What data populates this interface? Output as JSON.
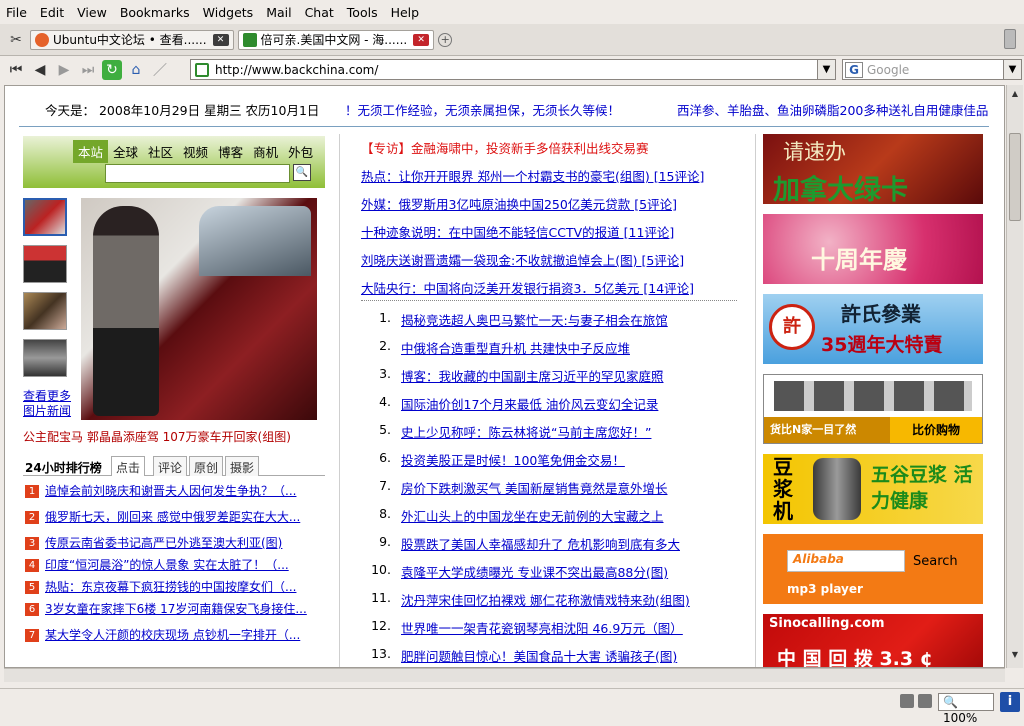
{
  "menu": [
    "File",
    "Edit",
    "View",
    "Bookmarks",
    "Widgets",
    "Mail",
    "Chat",
    "Tools",
    "Help"
  ],
  "tabs": [
    {
      "label": "Ubuntu中文论坛 • 查看......",
      "active": false,
      "icon_color": "#e5622a"
    },
    {
      "label": "倍可亲.美国中文网 - 海......",
      "active": true,
      "icon_color": "#2e8b2e"
    }
  ],
  "address": {
    "url": "http://www.backchina.com/"
  },
  "search": {
    "placeholder": "Google",
    "engine_icon": "G"
  },
  "status": {
    "zoom": "100%",
    "info": "i"
  },
  "page": {
    "date_line": "今天是： 2008年10月29日 星期三 农历10月1日",
    "top_ad1": "！无须工作经验，无须亲属担保，无须长久等候！",
    "top_ad2": "西洋参、羊胎盘、鱼油卵磷脂200多种送礼自用健康佳品",
    "green_tabs": [
      "本站",
      "全球",
      "社区",
      "视频",
      "博客",
      "商机",
      "外包"
    ],
    "more_photos": "查看更多图片新闻",
    "photo_caption": "公主配宝马 郭晶晶添座驾 107万豪车开回家(组图)",
    "rank_title": "24小时排行榜",
    "rank_tabs": [
      "点击",
      "评论",
      "原创",
      "摄影"
    ],
    "rank_items": [
      {
        "n": "1",
        "text": "追悼会前刘晓庆和谢晋夫人因何发生争执？（..."
      },
      {
        "n": "2",
        "text": "俄罗斯七天，刚回来 感觉中俄罗差距实在大大..."
      },
      {
        "n": "3",
        "text": "传原云南省委书记高严已外逃至澳大利亚(图)"
      },
      {
        "n": "4",
        "text": "印度“恒河晨浴”的惊人景象 实在太脏了！（..."
      },
      {
        "n": "5",
        "text": "热贴：东京夜幕下疯狂捞钱的中国按摩女们（..."
      },
      {
        "n": "6",
        "text": "3岁女童在家摔下6楼 17岁河南籍保安飞身接住..."
      },
      {
        "n": "7",
        "text": "某大学令人汗颜的校庆现场 点钞机一字排开（..."
      }
    ],
    "special": "【专访】金融海啸中，投资新手多倍获利出线交易赛",
    "headlines": [
      "热点：让你开开眼界 郑州一个村霸支书的豪宅(组图) [15评论]",
      "外媒：俄罗斯用3亿吨原油换中国250亿美元贷款 [5评论]",
      "十种迹象说明：在中国绝不能轻信CCTV的报道 [11评论]",
      "刘晓庆送谢晋遗孀一袋现金:不收就撤追悼会上(图) [5评论]",
      "大陆央行：中国将向泛美开发银行捐资3．5亿美元 [14评论]"
    ],
    "numbered": [
      {
        "n": "1.",
        "text": "揭秘竞选超人奥巴马繁忙一天:与妻子相会在旅馆"
      },
      {
        "n": "2.",
        "text": "中俄将合造重型直升机 共建快中子反应堆"
      },
      {
        "n": "3.",
        "text": "博客：我收藏的中国副主席习近平的罕见家庭照"
      },
      {
        "n": "4.",
        "text": "国际油价创17个月来最低 油价风云变幻全记录"
      },
      {
        "n": "5.",
        "text": "史上少见称呼：陈云林将说“马前主席您好！”"
      },
      {
        "n": "6.",
        "text": "投资美股正是时候！100笔免佣金交易！"
      },
      {
        "n": "7.",
        "text": "房价下跌刺激买气 美国新屋销售竟然是意外增长"
      },
      {
        "n": "8.",
        "text": "外汇山头上的中国龙坐在史无前例的大宝藏之上"
      },
      {
        "n": "9.",
        "text": "股票跌了美国人幸福感却升了 危机影响到底有多大"
      },
      {
        "n": "10.",
        "text": "袁隆平大学成绩曝光 专业课不突出最高88分(图)"
      },
      {
        "n": "11.",
        "text": "沈丹萍宋佳回忆拍裸戏 娜仁花称激情戏特来劲(组图)"
      },
      {
        "n": "12.",
        "text": "世界唯一一架青花瓷钢琴亮相沈阳 46.9万元（图）"
      },
      {
        "n": "13.",
        "text": "肥胖问题触目惊心！美国食品十大害 诱骗孩子(图)"
      }
    ],
    "ads": {
      "a1_line1": "请速办",
      "a1_line2": "加拿大绿卡",
      "a2": "十周年慶",
      "a3_line1": "許氏參業",
      "a3_line2": "35週年大特賣",
      "a3_badge": "許",
      "a4_left": "货比N家一目了然",
      "a4_right": "比价购物",
      "a5_left": "豆浆机",
      "a5_right": "五谷豆浆 活力健康",
      "a6_brand": "Alibaba",
      "a6_search": "Search",
      "a6_sub": "mp3 player",
      "a7_top": "Sinocalling.com",
      "a7_bottom": "中 国 回 拨 3.3 ¢"
    }
  }
}
